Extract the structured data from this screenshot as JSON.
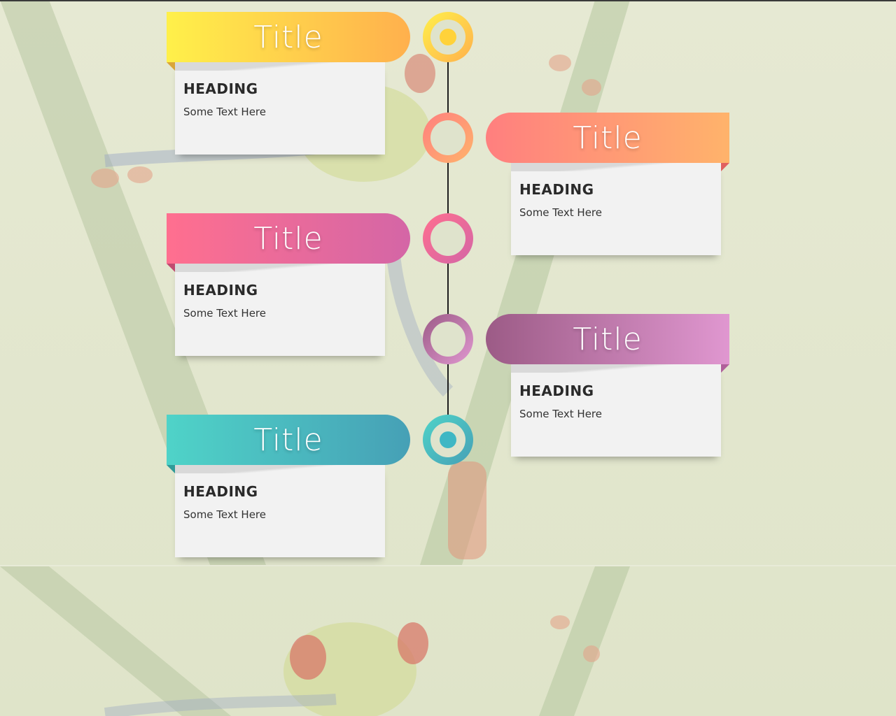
{
  "timeline": {
    "items": [
      {
        "side": "left",
        "title": "Title",
        "heading": "HEADING",
        "text": "Some Text Here",
        "node_style": "dot",
        "colors": {
          "start": "#fff04a",
          "end": "#ffb04d",
          "fold": "#d9a53a",
          "dot": "#ffd23a"
        }
      },
      {
        "side": "right",
        "title": "Title",
        "heading": "HEADING",
        "text": "Some Text Here",
        "node_style": "ring",
        "colors": {
          "start": "#ff7f7f",
          "end": "#ffb36b",
          "fold": "#e06060",
          "dot": ""
        }
      },
      {
        "side": "left",
        "title": "Title",
        "heading": "HEADING",
        "text": "Some Text Here",
        "node_style": "ring",
        "colors": {
          "start": "#ff6f8f",
          "end": "#d466a6",
          "fold": "#c04a70",
          "dot": ""
        }
      },
      {
        "side": "right",
        "title": "Title",
        "heading": "HEADING",
        "text": "Some Text Here",
        "node_style": "ring",
        "colors": {
          "start": "#9c5b86",
          "end": "#e097d0",
          "fold": "#b0609a",
          "dot": ""
        }
      },
      {
        "side": "left",
        "title": "Title",
        "heading": "HEADING",
        "text": "Some Text Here",
        "node_style": "dot",
        "colors": {
          "start": "#4fd3c8",
          "end": "#46a0b6",
          "fold": "#2f9a98",
          "dot": "#3fb7c4"
        }
      }
    ]
  }
}
